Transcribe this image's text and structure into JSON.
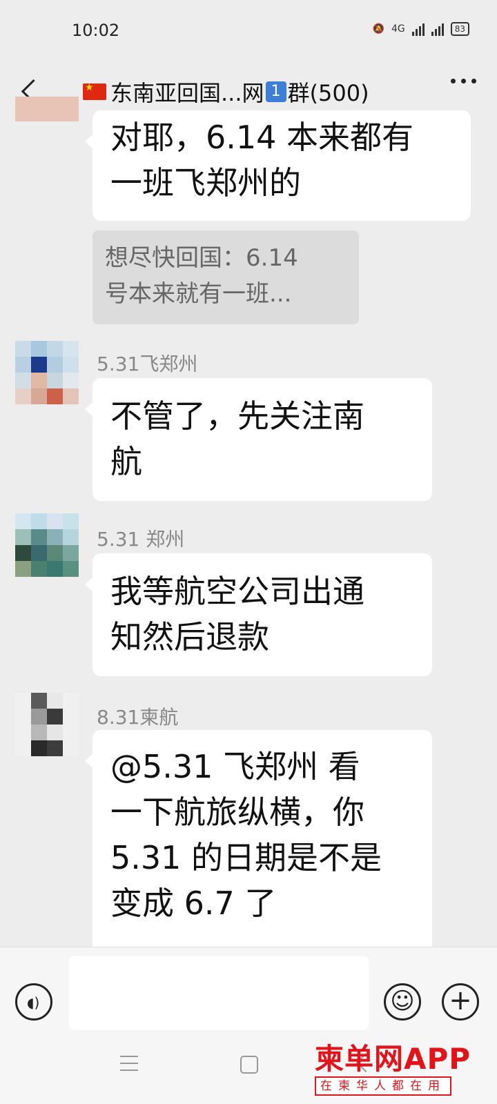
{
  "status_bar": {
    "time": "10:02",
    "network": "4G",
    "battery": "83"
  },
  "header": {
    "title": "东南亚回国...网",
    "title_badge": "1",
    "title_suffix": "群(500)"
  },
  "messages": [
    {
      "sender": "",
      "lines": [
        "对耶，6.14 本来都有",
        "一班飞郑州的"
      ],
      "quote_lines": [
        "想尽快回国：6.14",
        "号本来就有一班..."
      ]
    },
    {
      "sender": "5.31飞郑州",
      "lines": [
        "不管了，先关注南",
        "航"
      ]
    },
    {
      "sender": "5.31  郑州",
      "lines": [
        "我等航空公司出通",
        "知然后退款"
      ]
    },
    {
      "sender": "8.31柬航",
      "lines": [
        "@5.31 飞郑州  看",
        "一下航旅纵横，你",
        "5.31 的日期是不是",
        "变成 6.7 了"
      ]
    }
  ],
  "watermark": {
    "main": "柬单网APP",
    "sub": "在柬华人都在用"
  },
  "colors": {
    "background": "#ededed",
    "bubble": "#ffffff",
    "quote": "#dcdcdc",
    "watermark": "#e1131b",
    "badge": "#3d7fd6"
  }
}
